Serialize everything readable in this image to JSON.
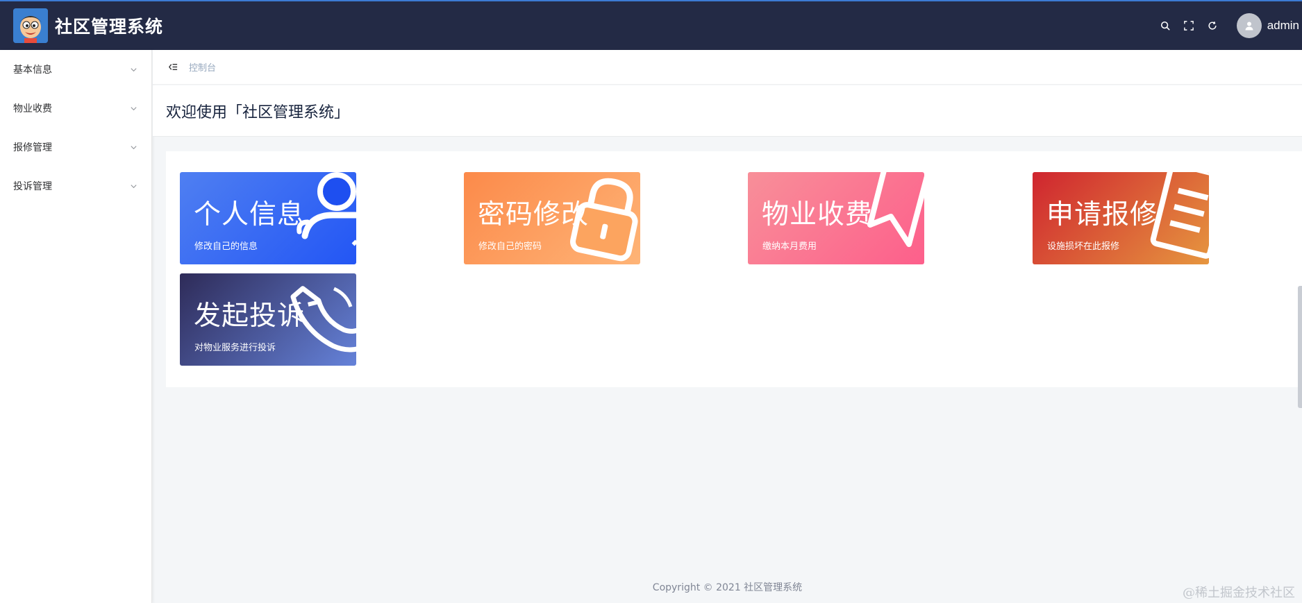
{
  "header": {
    "app_title": "社区管理系统",
    "username": "admin",
    "icons": [
      "search-icon",
      "fullscreen-icon",
      "refresh-icon",
      "user-icon"
    ]
  },
  "sidebar": {
    "items": [
      {
        "label": "基本信息"
      },
      {
        "label": "物业收费"
      },
      {
        "label": "报修管理"
      },
      {
        "label": "投诉管理"
      }
    ]
  },
  "topbar": {
    "breadcrumb": "控制台"
  },
  "page": {
    "title": "欢迎使用「社区管理系统」"
  },
  "cards": [
    {
      "title": "个人信息",
      "subtitle": "修改自己的信息",
      "icon": "user-icon"
    },
    {
      "title": "密码修改",
      "subtitle": "修改自己的密码",
      "icon": "lock-icon"
    },
    {
      "title": "物业收费",
      "subtitle": "缴纳本月费用",
      "icon": "bookmark-icon"
    },
    {
      "title": "申请报修",
      "subtitle": "设施损坏在此报修",
      "icon": "document-icon"
    },
    {
      "title": "发起投诉",
      "subtitle": "对物业服务进行投诉",
      "icon": "phone-icon"
    }
  ],
  "footer": {
    "copyright": "Copyright © 2021 社区管理系统",
    "watermark": "@稀土掘金技术社区"
  },
  "colors": {
    "header_bg": "#232a45",
    "accent": "#3c7bd4"
  }
}
